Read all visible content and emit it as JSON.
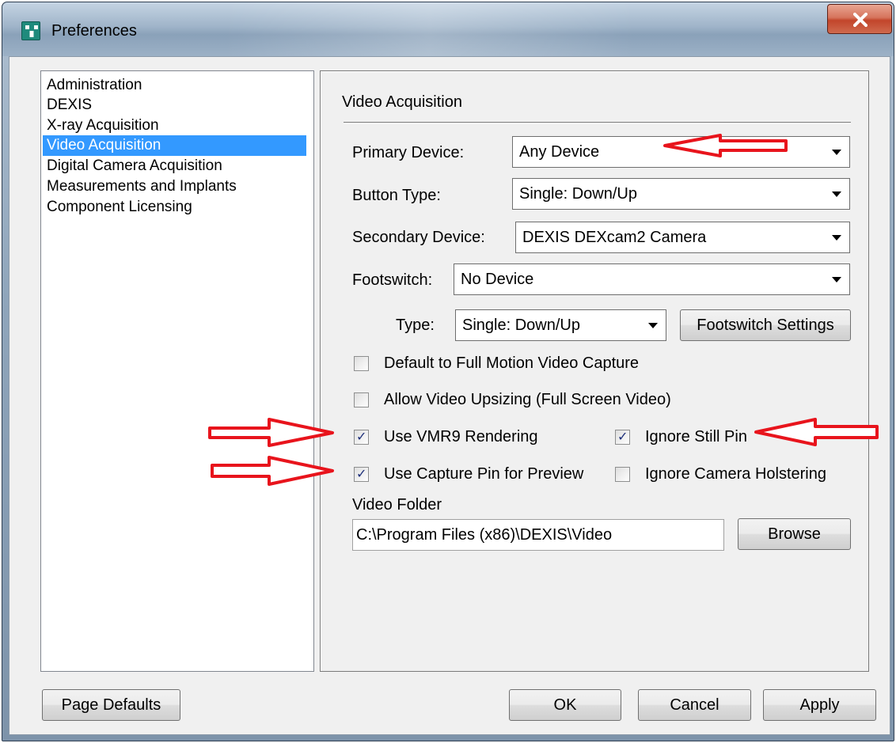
{
  "window": {
    "title": "Preferences",
    "close_label": "X"
  },
  "nav": {
    "items": [
      {
        "label": "Administration",
        "selected": false
      },
      {
        "label": "DEXIS",
        "selected": false
      },
      {
        "label": "X-ray Acquisition",
        "selected": false
      },
      {
        "label": "Video Acquisition",
        "selected": true
      },
      {
        "label": "Digital Camera Acquisition",
        "selected": false
      },
      {
        "label": "Measurements and Implants",
        "selected": false
      },
      {
        "label": "Component Licensing",
        "selected": false
      }
    ]
  },
  "panel": {
    "title": "Video Acquisition",
    "primary_device": {
      "label": "Primary Device:",
      "value": "Any Device"
    },
    "button_type": {
      "label": "Button Type:",
      "value": "Single: Down/Up"
    },
    "secondary_device": {
      "label": "Secondary Device:",
      "value": "DEXIS DEXcam2 Camera"
    },
    "footswitch": {
      "label": "Footswitch:",
      "value": "No Device"
    },
    "type": {
      "label": "Type:",
      "value": "Single: Down/Up"
    },
    "footswitch_settings_label": "Footswitch Settings",
    "checkboxes": {
      "full_motion": {
        "label": "Default to Full Motion Video Capture",
        "checked": false
      },
      "upsizing": {
        "label": "Allow Video Upsizing (Full Screen Video)",
        "checked": false
      },
      "vmr9": {
        "label": "Use VMR9 Rendering",
        "checked": true
      },
      "still_pin": {
        "label": "Ignore Still Pin",
        "checked": true
      },
      "capture_pin": {
        "label": "Use Capture Pin for Preview",
        "checked": true
      },
      "holstering": {
        "label": "Ignore Camera Holstering",
        "checked": false
      }
    },
    "video_folder": {
      "label": "Video Folder",
      "value": "C:\\Program Files (x86)\\DEXIS\\Video",
      "browse_label": "Browse"
    }
  },
  "footer": {
    "page_defaults_label": "Page Defaults",
    "ok_label": "OK",
    "cancel_label": "Cancel",
    "apply_label": "Apply"
  },
  "colors": {
    "selection": "#3399ff",
    "annotation_arrow": "#e8141c",
    "close_button": "#c7482e"
  },
  "icons": {
    "app": "radiation-grid-icon",
    "close": "close-x-icon",
    "dropdown": "triangle-down-icon",
    "check": "checkmark-icon",
    "annotation": "red-arrow-icon"
  }
}
